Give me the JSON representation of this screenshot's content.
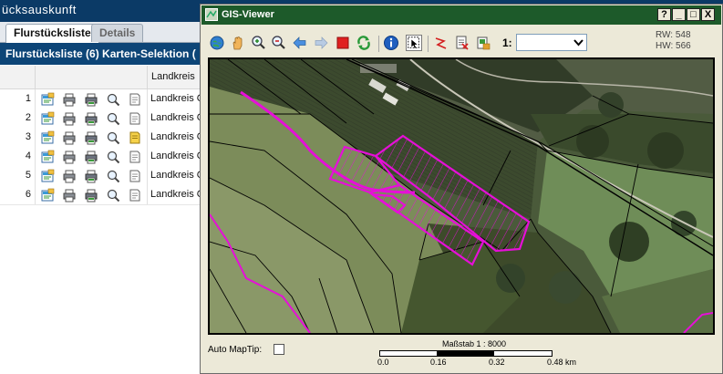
{
  "app": {
    "header_title": "ücksauskunft",
    "tabs": [
      {
        "label": "Flurstücksliste",
        "active": true
      },
      {
        "label": "Details",
        "active": false
      }
    ],
    "list_title": "Flurstücksliste (6) Karten-Selektion (",
    "column_header": "Landkreis",
    "rows": [
      {
        "num": "1",
        "landkreis": "Landkreis C"
      },
      {
        "num": "2",
        "landkreis": "Landkreis C"
      },
      {
        "num": "3",
        "landkreis": "Landkreis C"
      },
      {
        "num": "4",
        "landkreis": "Landkreis C"
      },
      {
        "num": "5",
        "landkreis": "Landkreis C"
      },
      {
        "num": "6",
        "landkreis": "Landkreis C"
      }
    ],
    "row_icons": [
      "details-icon",
      "print-icon",
      "print-map-icon",
      "zoom-icon",
      "note-icon"
    ]
  },
  "viewer": {
    "title": "GIS-Viewer",
    "window_buttons": [
      "?",
      "_",
      "□",
      "X"
    ],
    "toolbar_icons": [
      "globe-icon",
      "pan-hand-icon",
      "zoom-in-icon",
      "zoom-out-icon",
      "back-arrow-icon",
      "forward-arrow-icon",
      "stop-icon",
      "refresh-icon",
      "info-icon",
      "select-icon",
      "measure-icon",
      "print-icon",
      "export-icon"
    ],
    "scale_label": "1:",
    "scale_value": "",
    "rw": "RW: 548",
    "hw": "HW: 566",
    "auto_maptip_label": "Auto MapTip:",
    "scalebar_title": "Maßstab 1 : 8000",
    "scalebar_ticks": [
      "0.0",
      "0.16",
      "0.32",
      "0.48 km"
    ],
    "colors": {
      "titlebar": "#1d5a2a",
      "selection": "#e60fd8"
    }
  }
}
